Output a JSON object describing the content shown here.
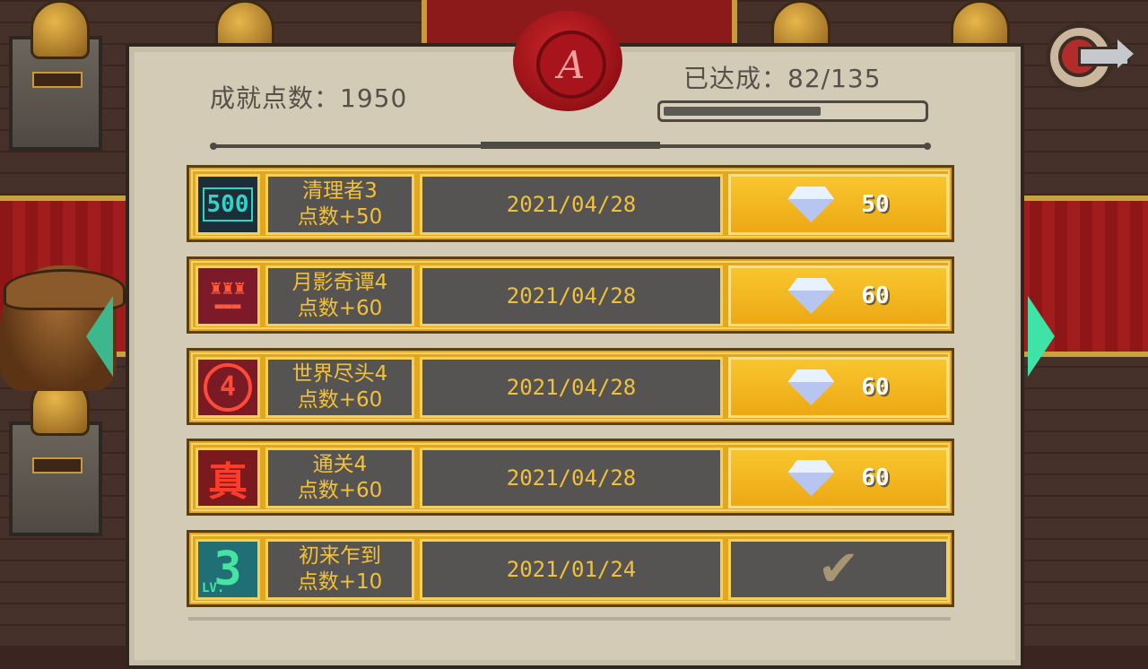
{
  "header": {
    "points_label": "成就点数：1950",
    "progress_label": "已达成：82/135",
    "progress_fraction": 0.607,
    "seal_letter": "A"
  },
  "achievements": [
    {
      "name": "清理者3",
      "points": "点数+50",
      "date": "2021/04/28",
      "reward": "50",
      "claimed": false,
      "icon": "cleaner-500-icon",
      "icon_text": "500"
    },
    {
      "name": "月影奇谭4",
      "points": "点数+60",
      "date": "2021/04/28",
      "reward": "60",
      "claimed": false,
      "icon": "moon-shadow-icon",
      "icon_text": ""
    },
    {
      "name": "世界尽头4",
      "points": "点数+60",
      "date": "2021/04/28",
      "reward": "60",
      "claimed": false,
      "icon": "world-end-icon",
      "icon_text": "4"
    },
    {
      "name": "通关4",
      "points": "点数+60",
      "date": "2021/04/28",
      "reward": "60",
      "claimed": false,
      "icon": "clear-true-icon",
      "icon_text": "真"
    },
    {
      "name": "初来乍到",
      "points": "点数+10",
      "date": "2021/01/24",
      "reward": "",
      "claimed": true,
      "icon": "level-3-icon",
      "icon_text": "3",
      "icon_subtext": "LV."
    }
  ],
  "colors": {
    "row_gold": "#e2a71d",
    "text_gold": "#f2c13a",
    "cell_dark": "#565452",
    "parchment": "#d4cbb6",
    "arrow_teal": "#3fe3a8"
  }
}
